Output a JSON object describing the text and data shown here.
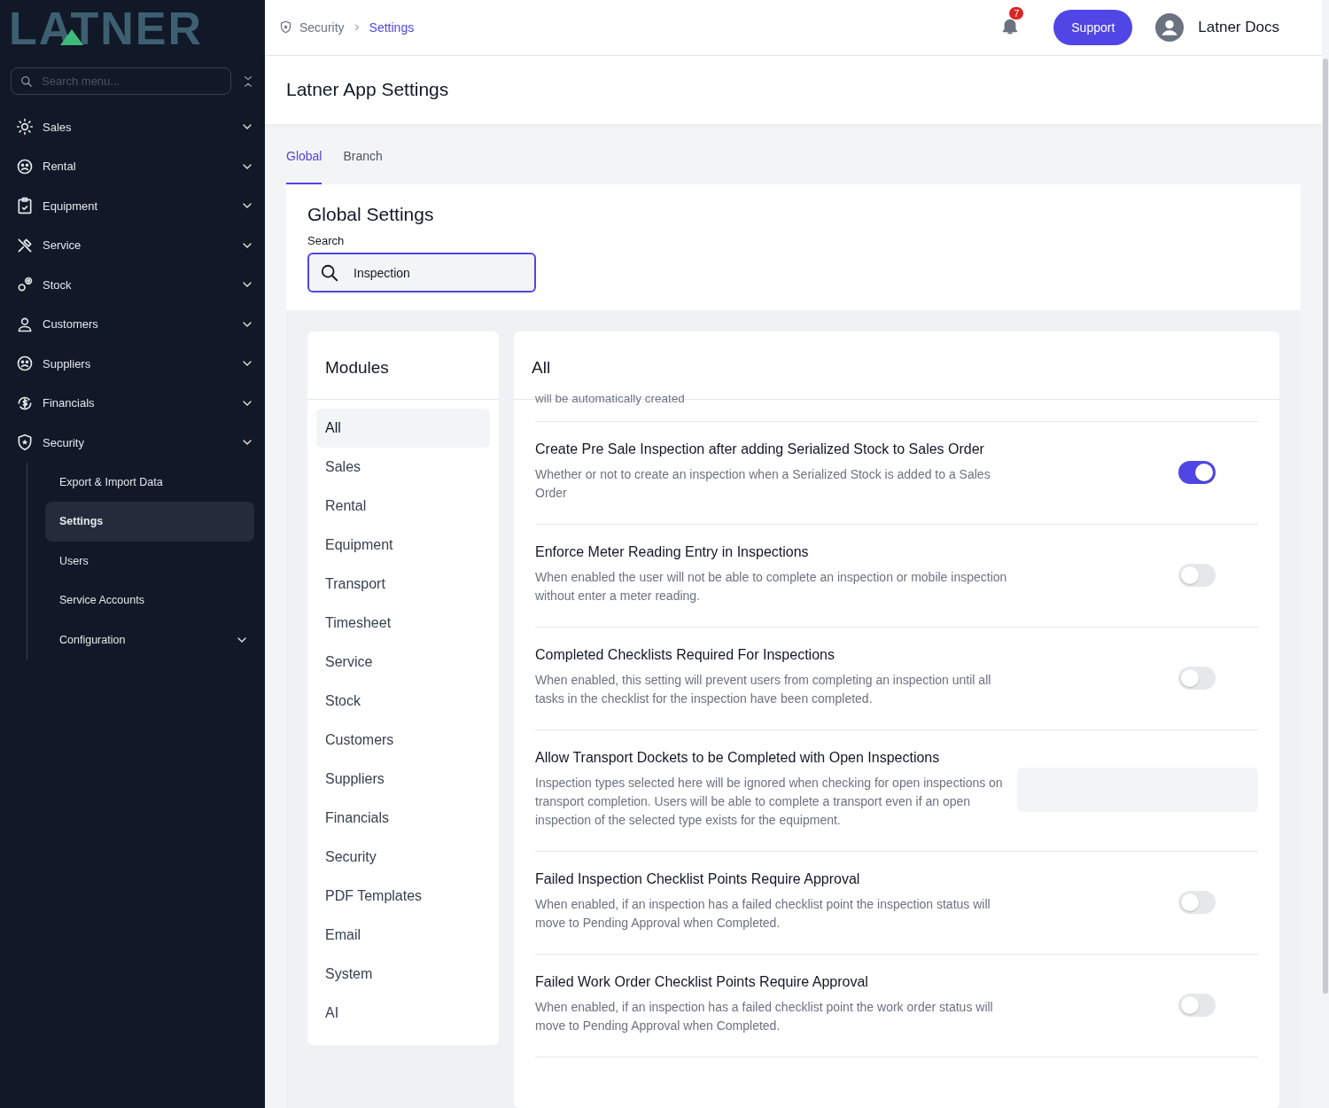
{
  "logo": "LATNER",
  "sidebar": {
    "search": {
      "placeholder": "Search menu..."
    },
    "items": [
      {
        "label": "Sales"
      },
      {
        "label": "Rental"
      },
      {
        "label": "Equipment"
      },
      {
        "label": "Service"
      },
      {
        "label": "Stock"
      },
      {
        "label": "Customers"
      },
      {
        "label": "Suppliers"
      },
      {
        "label": "Financials"
      },
      {
        "label": "Security",
        "children": [
          {
            "kind": "link",
            "label": "Export & Import Data",
            "selected": false
          },
          {
            "kind": "link",
            "label": "Settings",
            "selected": true
          },
          {
            "kind": "link",
            "label": "Users",
            "selected": false
          },
          {
            "kind": "link",
            "label": "Service Accounts",
            "selected": false
          },
          {
            "kind": "group",
            "label": "Configuration",
            "selected": false
          }
        ]
      }
    ]
  },
  "header": {
    "breadcrumb": [
      "Security",
      "Settings"
    ],
    "notifications": "7",
    "support": "Support",
    "user": "Latner Docs"
  },
  "page_title": "Latner App Settings",
  "tabs": [
    {
      "label": "Global",
      "selected": true
    },
    {
      "label": "Branch",
      "selected": false
    }
  ],
  "global": {
    "title": "Global Settings",
    "search_label": "Search",
    "search_value": "Inspection"
  },
  "modules": {
    "title": "Modules",
    "items": [
      {
        "label": "All",
        "selected": true
      },
      {
        "label": "Sales",
        "selected": false
      },
      {
        "label": "Rental",
        "selected": false
      },
      {
        "label": "Equipment",
        "selected": false
      },
      {
        "label": "Transport",
        "selected": false
      },
      {
        "label": "Timesheet",
        "selected": false
      },
      {
        "label": "Service",
        "selected": false
      },
      {
        "label": "Stock",
        "selected": false
      },
      {
        "label": "Customers",
        "selected": false
      },
      {
        "label": "Suppliers",
        "selected": false
      },
      {
        "label": "Financials",
        "selected": false
      },
      {
        "label": "Security",
        "selected": false
      },
      {
        "label": "PDF Templates",
        "selected": false
      },
      {
        "label": "Email",
        "selected": false
      },
      {
        "label": "System",
        "selected": false
      },
      {
        "label": "AI",
        "selected": false
      }
    ]
  },
  "settings": {
    "title": "All",
    "cut_text": "will be automatically created",
    "rows": [
      {
        "kind": "toggle",
        "title": "Create Pre Sale Inspection after adding Serialized Stock to Sales Order",
        "description": "Whether or not to create an inspection when a Serialized Stock is added to a Sales Order",
        "on": true
      },
      {
        "kind": "toggle",
        "title": "Enforce Meter Reading Entry in Inspections",
        "description": "When enabled the user will not be able to complete an inspection or mobile inspection without enter a meter reading.",
        "on": false
      },
      {
        "kind": "toggle",
        "title": "Completed Checklists Required For Inspections",
        "description": "When enabled, this setting will prevent users from completing an inspection until all tasks in the checklist for the inspection have been completed.",
        "on": false
      },
      {
        "kind": "select",
        "title": "Allow Transport Dockets to be Completed with Open Inspections",
        "description": "Inspection types selected here will be ignored when checking for open inspections on transport completion. Users will be able to complete a transport even if an open inspection of the selected type exists for the equipment."
      },
      {
        "kind": "toggle",
        "title": "Failed Inspection Checklist Points Require Approval",
        "description": "When enabled, if an inspection has a failed checklist point the inspection status will move to Pending Approval when Completed.",
        "on": false
      },
      {
        "kind": "toggle",
        "title": "Failed Work Order Checklist Points Require Approval",
        "description": "When enabled, if an inspection has a failed checklist point the work order status will move to Pending Approval when Completed.",
        "on": false
      }
    ]
  }
}
